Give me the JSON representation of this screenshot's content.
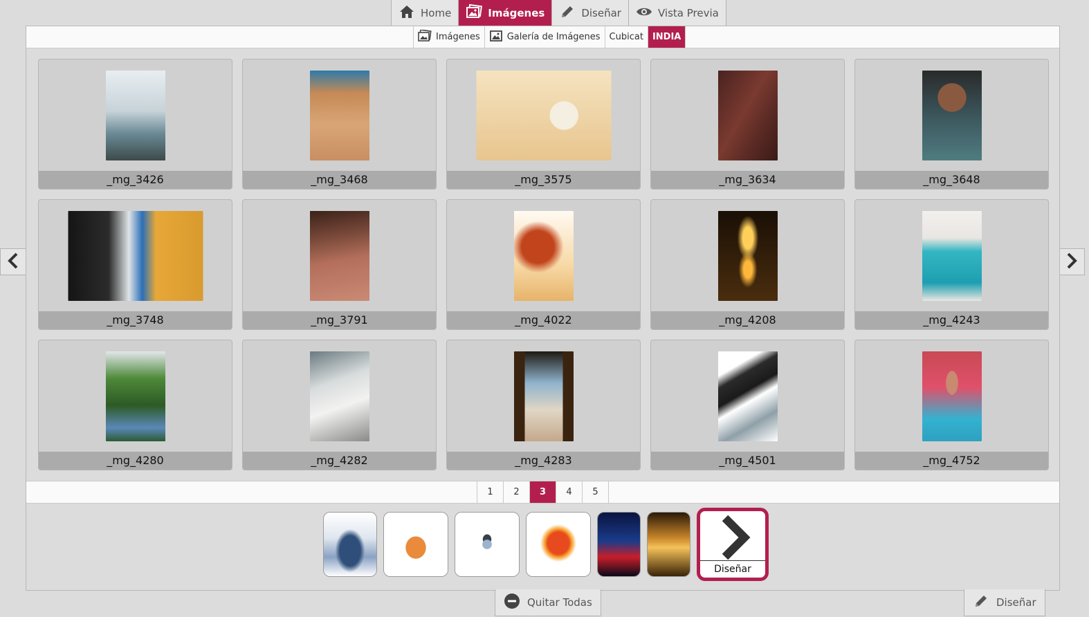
{
  "top_tabs": [
    {
      "label": "Home",
      "icon": "home-icon"
    },
    {
      "label": "Imágenes",
      "icon": "images-icon"
    },
    {
      "label": "Diseñar",
      "icon": "pencil-icon"
    },
    {
      "label": "Vista Previa",
      "icon": "eye-icon"
    }
  ],
  "active_top_tab": "Imágenes",
  "breadcrumb": [
    {
      "label": "Imágenes",
      "icon": "images-icon"
    },
    {
      "label": "Galería de Imágenes",
      "icon": "picture-icon"
    },
    {
      "label": "Cubicat",
      "icon": ""
    },
    {
      "label": "INDIA",
      "icon": ""
    }
  ],
  "images": [
    {
      "label": "_mg_3426"
    },
    {
      "label": "_mg_3468"
    },
    {
      "label": "_mg_3575"
    },
    {
      "label": "_mg_3634"
    },
    {
      "label": "_mg_3648"
    },
    {
      "label": "_mg_3748"
    },
    {
      "label": "_mg_3791"
    },
    {
      "label": "_mg_4022"
    },
    {
      "label": "_mg_4208"
    },
    {
      "label": "_mg_4243"
    },
    {
      "label": "_mg_4280"
    },
    {
      "label": "_mg_4282"
    },
    {
      "label": "_mg_4283"
    },
    {
      "label": "_mg_4501"
    },
    {
      "label": "_mg_4752"
    }
  ],
  "pagination": {
    "pages": [
      "1",
      "2",
      "3",
      "4",
      "5"
    ],
    "current": "3"
  },
  "tray": {
    "design_label": "Diseñar"
  },
  "bottom": {
    "remove_all_label": "Quitar Todas",
    "design_label": "Diseñar"
  },
  "colors": {
    "accent": "#b21f4e",
    "background": "#dcdcdc",
    "card": "#d0d0d0",
    "caption": "#ababab"
  }
}
